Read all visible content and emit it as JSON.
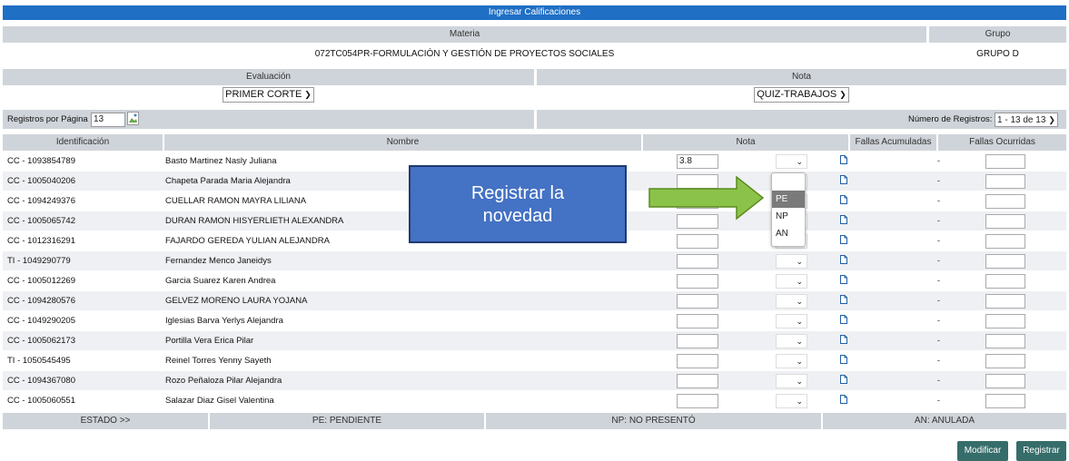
{
  "title": "Ingresar Calificaciones",
  "headers": {
    "materia": "Materia",
    "grupo": "Grupo",
    "evaluacion": "Evaluación",
    "nota": "Nota"
  },
  "materia_value": "072TC054PR-FORMULACIÓN Y GESTIÓN DE PROYECTOS SOCIALES",
  "grupo_value": "GRUPO D",
  "evaluacion_value": "PRIMER CORTE",
  "nota_value": "QUIZ-TRABAJOS",
  "registros_label": "Registros por Página",
  "registros_value": "13",
  "numero_label": "Número de Registros:",
  "numero_value": "1 - 13 de 13",
  "columns": {
    "id": "Identificación",
    "nombre": "Nombre",
    "nota": "Nota",
    "fallas_acum": "Fallas Acumuladas",
    "fallas_ocurr": "Fallas Ocurridas"
  },
  "students": [
    {
      "id": "CC - 1093854789",
      "name": "Basto Martinez Nasly Juliana",
      "nota": "3.8",
      "fallas": "-"
    },
    {
      "id": "CC - 1005040206",
      "name": "Chapeta Parada Maria Alejandra",
      "nota": "",
      "fallas": "-"
    },
    {
      "id": "CC - 1094249376",
      "name": "CUELLAR RAMON MAYRA LILIANA",
      "nota": "",
      "fallas": "-"
    },
    {
      "id": "CC - 1005065742",
      "name": "DURAN RAMON HISYERLIETH ALEXANDRA",
      "nota": "",
      "fallas": "-"
    },
    {
      "id": "CC - 1012316291",
      "name": "FAJARDO GEREDA YULIAN ALEJANDRA",
      "nota": "",
      "fallas": "-"
    },
    {
      "id": "TI - 1049290779",
      "name": "Fernandez Menco Janeidys",
      "nota": "",
      "fallas": "-"
    },
    {
      "id": "CC - 1005012269",
      "name": "Garcia Suarez Karen Andrea",
      "nota": "",
      "fallas": "-"
    },
    {
      "id": "CC - 1094280576",
      "name": "GELVEZ MORENO LAURA YOJANA",
      "nota": "",
      "fallas": "-"
    },
    {
      "id": "CC - 1049290205",
      "name": "Iglesias Barva Yerlys Alejandra",
      "nota": "",
      "fallas": "-"
    },
    {
      "id": "CC - 1005062173",
      "name": "Portilla Vera Erica Pilar",
      "nota": "",
      "fallas": "-"
    },
    {
      "id": "TI - 1050545495",
      "name": "Reinel Torres Yenny Sayeth",
      "nota": "",
      "fallas": "-"
    },
    {
      "id": "CC - 1094367080",
      "name": "Rozo Peñaloza Pilar Alejandra",
      "nota": "",
      "fallas": "-"
    },
    {
      "id": "CC - 1005060551",
      "name": "Salazar Diaz Gisel Valentina",
      "nota": "",
      "fallas": "-"
    }
  ],
  "dropdown_options": [
    "PE",
    "NP",
    "AN"
  ],
  "dropdown_selected": "PE",
  "callout": {
    "line1": "Registrar la",
    "line2": "novedad"
  },
  "estado": {
    "label": "ESTADO >>",
    "pe": "PE: PENDIENTE",
    "np": "NP: NO PRESENTÓ",
    "an": "AN: ANULADA"
  },
  "buttons": {
    "modificar": "Modificar",
    "registrar": "Registrar"
  },
  "icons": {
    "image": "broken-image-icon",
    "doc": "document-icon",
    "chevron": "chevron-down-icon",
    "arrow": "arrow-right-icon"
  },
  "colors": {
    "title_bar": "#1f6fc5",
    "header": "#cfd4da",
    "button": "#366d6a",
    "callout": "#4472c4",
    "arrow": "#8bc34a"
  }
}
